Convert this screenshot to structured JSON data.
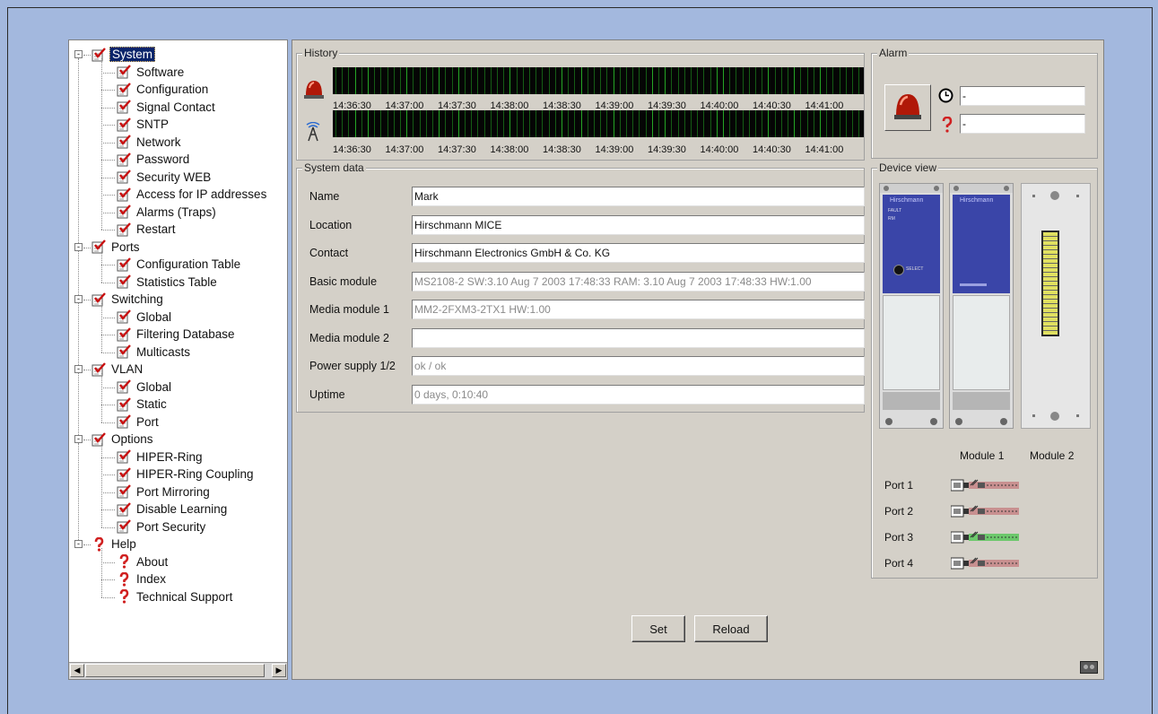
{
  "tree": {
    "items": [
      {
        "label": "System",
        "level": 0,
        "icon": "check-page-icon",
        "selected": true,
        "expander": "-"
      },
      {
        "label": "Software",
        "level": 1,
        "icon": "check-page-icon"
      },
      {
        "label": "Configuration",
        "level": 1,
        "icon": "check-page-icon"
      },
      {
        "label": "Signal Contact",
        "level": 1,
        "icon": "check-page-icon"
      },
      {
        "label": "SNTP",
        "level": 1,
        "icon": "check-page-icon"
      },
      {
        "label": "Network",
        "level": 1,
        "icon": "check-page-icon"
      },
      {
        "label": "Password",
        "level": 1,
        "icon": "check-page-icon"
      },
      {
        "label": "Security WEB",
        "level": 1,
        "icon": "check-page-icon"
      },
      {
        "label": "Access for IP addresses",
        "level": 1,
        "icon": "check-page-icon"
      },
      {
        "label": "Alarms (Traps)",
        "level": 1,
        "icon": "check-page-icon"
      },
      {
        "label": "Restart",
        "level": 1,
        "icon": "check-page-icon"
      },
      {
        "label": "Ports",
        "level": 0,
        "icon": "check-page-icon",
        "expander": "-"
      },
      {
        "label": "Configuration Table",
        "level": 1,
        "icon": "check-page-icon"
      },
      {
        "label": "Statistics Table",
        "level": 1,
        "icon": "check-page-icon"
      },
      {
        "label": "Switching",
        "level": 0,
        "icon": "check-page-icon",
        "expander": "-"
      },
      {
        "label": "Global",
        "level": 1,
        "icon": "check-page-icon"
      },
      {
        "label": "Filtering Database",
        "level": 1,
        "icon": "check-page-icon"
      },
      {
        "label": "Multicasts",
        "level": 1,
        "icon": "check-page-icon"
      },
      {
        "label": "VLAN",
        "level": 0,
        "icon": "check-page-icon",
        "expander": "-"
      },
      {
        "label": "Global",
        "level": 1,
        "icon": "check-page-icon"
      },
      {
        "label": "Static",
        "level": 1,
        "icon": "check-page-icon"
      },
      {
        "label": "Port",
        "level": 1,
        "icon": "check-page-icon"
      },
      {
        "label": "Options",
        "level": 0,
        "icon": "check-page-icon",
        "expander": "-"
      },
      {
        "label": "HIPER-Ring",
        "level": 1,
        "icon": "check-page-icon"
      },
      {
        "label": "HIPER-Ring Coupling",
        "level": 1,
        "icon": "check-page-icon"
      },
      {
        "label": "Port Mirroring",
        "level": 1,
        "icon": "check-page-icon"
      },
      {
        "label": "Disable Learning",
        "level": 1,
        "icon": "check-page-icon"
      },
      {
        "label": "Port Security",
        "level": 1,
        "icon": "check-page-icon"
      },
      {
        "label": "Help",
        "level": 0,
        "icon": "question-icon",
        "expander": "-"
      },
      {
        "label": "About",
        "level": 1,
        "icon": "question-icon"
      },
      {
        "label": "Index",
        "level": 1,
        "icon": "question-icon"
      },
      {
        "label": "Technical Support",
        "level": 1,
        "icon": "question-icon"
      }
    ]
  },
  "history": {
    "title": "History",
    "alarm_icon": "alarm-beacon-icon",
    "trap_icon": "antenna-icon",
    "times": [
      "14:36:30",
      "14:37:00",
      "14:37:30",
      "14:38:00",
      "14:38:30",
      "14:39:00",
      "14:39:30",
      "14:40:00",
      "14:40:30",
      "14:41:00"
    ]
  },
  "alarm": {
    "title": "Alarm",
    "time_value": "-",
    "desc_value": "-",
    "icons": [
      "alarm-beacon-icon",
      "clock-icon",
      "question-icon"
    ]
  },
  "system_data": {
    "title": "System data",
    "fields": [
      {
        "label": "Name",
        "value": "Mark",
        "readonly": false
      },
      {
        "label": "Location",
        "value": "Hirschmann MICE",
        "readonly": false
      },
      {
        "label": "Contact",
        "value": "Hirschmann Electronics GmbH & Co. KG",
        "readonly": false
      },
      {
        "label": "Basic module",
        "value": "MS2108-2 SW:3.10 Aug  7 2003 17:48:33 RAM: 3.10 Aug  7 2003 17:48:33 HW:1.00",
        "readonly": true
      },
      {
        "label": "Media module 1",
        "value": "MM2-2FXM3-2TX1 HW:1.00",
        "readonly": true
      },
      {
        "label": "Media module 2",
        "value": "",
        "readonly": true
      },
      {
        "label": "Power supply 1/2",
        "value": "ok / ok",
        "readonly": true
      },
      {
        "label": "Uptime",
        "value": "0 days, 0:10:40",
        "readonly": true
      }
    ]
  },
  "device_view": {
    "title": "Device view",
    "module_headers": [
      "Module 1",
      "Module 2"
    ],
    "ports": [
      {
        "label": "Port 1",
        "status_color": "#c89090"
      },
      {
        "label": "Port 2",
        "status_color": "#c89090"
      },
      {
        "label": "Port 3",
        "status_color": "#6cc86c"
      },
      {
        "label": "Port 4",
        "status_color": "#c89090"
      }
    ],
    "module_texts": [
      "Hirschmann",
      "Hirschmann",
      "FAULT",
      "RM",
      "SELECT"
    ]
  },
  "buttons": {
    "set": "Set",
    "reload": "Reload"
  },
  "colors": {
    "selection": "#0a246a",
    "background": "#a3b8de",
    "panel": "#d4d0c8"
  }
}
